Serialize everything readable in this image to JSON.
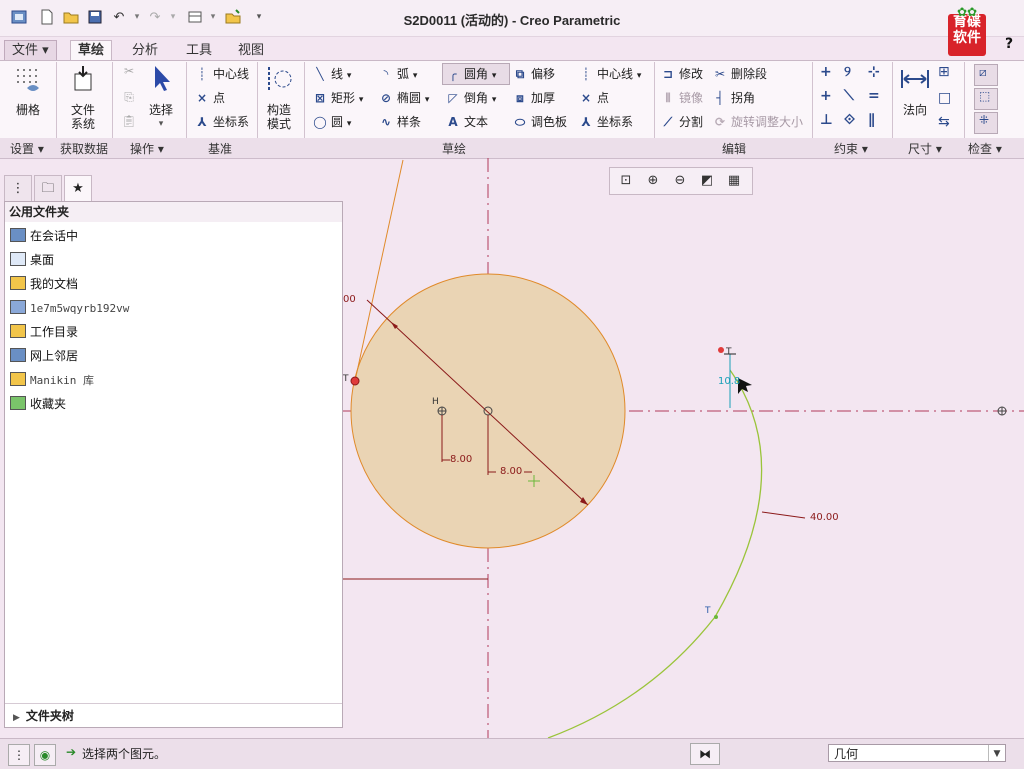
{
  "window": {
    "title": "S2D0011 (活动的) - Creo Parametric",
    "logo_line1": "育碟",
    "logo_line2": "软件",
    "help": "?"
  },
  "menu_tabs": [
    "文件",
    "草绘",
    "分析",
    "工具",
    "视图"
  ],
  "ribbon": {
    "settings": {
      "grid_label": "栅格",
      "group": "设置"
    },
    "get_data": {
      "file_system_label": "文件\n系统",
      "group": "获取数据"
    },
    "operations": {
      "select_label": "选择",
      "group": "操作"
    },
    "datum": {
      "items": [
        "中心线",
        "点",
        "坐标系"
      ],
      "group": "基准"
    },
    "construction": {
      "label": "构造\n模式"
    },
    "sketch": {
      "col1": [
        "线",
        "矩形",
        "圆"
      ],
      "col2": [
        "弧",
        "椭圆",
        "样条"
      ],
      "col3": [
        "圆角",
        "倒角",
        "文本"
      ],
      "col4": [
        "偏移",
        "加厚",
        "调色板"
      ],
      "col5": [
        "中心线",
        "点",
        "坐标系"
      ],
      "group": "草绘"
    },
    "edit": {
      "items": [
        "修改",
        "删除段",
        "镜像",
        "拐角",
        "分割",
        "旋转调整大小"
      ],
      "group": "编辑"
    },
    "constraint": {
      "group": "约束"
    },
    "dimension": {
      "normal_label": "法向",
      "group": "尺寸"
    },
    "inspect": {
      "group": "检查"
    }
  },
  "left_panel": {
    "tabs": [
      "model-tree-icon",
      "folder-browser-icon",
      "favorites-icon"
    ],
    "header": "公用文件夹",
    "items": [
      "在会话中",
      "桌面",
      "我的文档",
      "1e7m5wqyrb192vw",
      "工作目录",
      "网上邻居",
      "Manikin 库",
      "收藏夹"
    ],
    "footer": "文件夹树"
  },
  "sketch": {
    "dim_left_circle": "00",
    "dim_h_offset": "8.00",
    "dim_v_offset": "8.00",
    "dim_arc_radius": "40.00",
    "dim_small": "10.8",
    "tangent_label_1": "T",
    "tangent_label_2": "T",
    "tangent_label_3": "T",
    "horizontal_label": "H",
    "colors": {
      "circle_fill": "#ead4b4",
      "circle_stroke": "#e08a2a",
      "centerline": "#b23a5a",
      "dimension": "#8b1a1a",
      "arc": "#9ac43a"
    }
  },
  "status": {
    "message": "选择两个图元。",
    "filter_value": "几何"
  }
}
